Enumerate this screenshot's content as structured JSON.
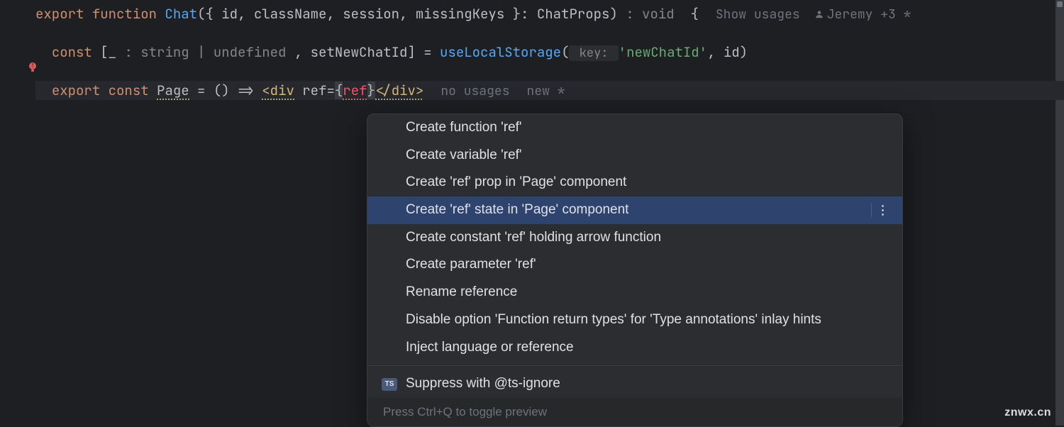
{
  "code": {
    "line1": {
      "export": "export",
      "function": "function",
      "fnName": "Chat",
      "params": "({ id, className, session, missingKeys }: ",
      "typeName": "ChatProps",
      "close": ")",
      "returnHint": " : void ",
      "brace": " {",
      "showUsages": "Show usages",
      "author": "Jeremy +3 *"
    },
    "line2": {
      "const": "const",
      "destruct": " [_ ",
      "typeHint": ": string | undefined ",
      "rest": ", setNewChatId] = ",
      "fnCall": "useLocalStorage",
      "open": "(",
      "keyHint": " key: ",
      "str": "'newChatId'",
      "tail": ", id)"
    },
    "line3": {
      "export": "export",
      "const": "const",
      "name": "Page",
      "arrow": " = () => ",
      "openTag": "<div",
      "attr": " ref",
      "eq": "=",
      "brace1": "{",
      "refVal": "ref",
      "brace2": "}",
      "closeTag": "</div>",
      "noUsages": "no usages",
      "status": "new *"
    }
  },
  "popup": {
    "items": [
      "Create function 'ref'",
      "Create variable 'ref'",
      "Create 'ref' prop in 'Page' component",
      "Create 'ref' state in 'Page' component",
      "Create constant 'ref' holding arrow function",
      "Create parameter 'ref'",
      "Rename reference",
      "Disable option 'Function return types' for 'Type annotations' inlay hints",
      "Inject language or reference"
    ],
    "selectedIndex": 3,
    "tsIcon": "TS",
    "suppress": "Suppress with @ts-ignore",
    "footer": "Press Ctrl+Q to toggle preview"
  },
  "watermark": "znwx.cn"
}
